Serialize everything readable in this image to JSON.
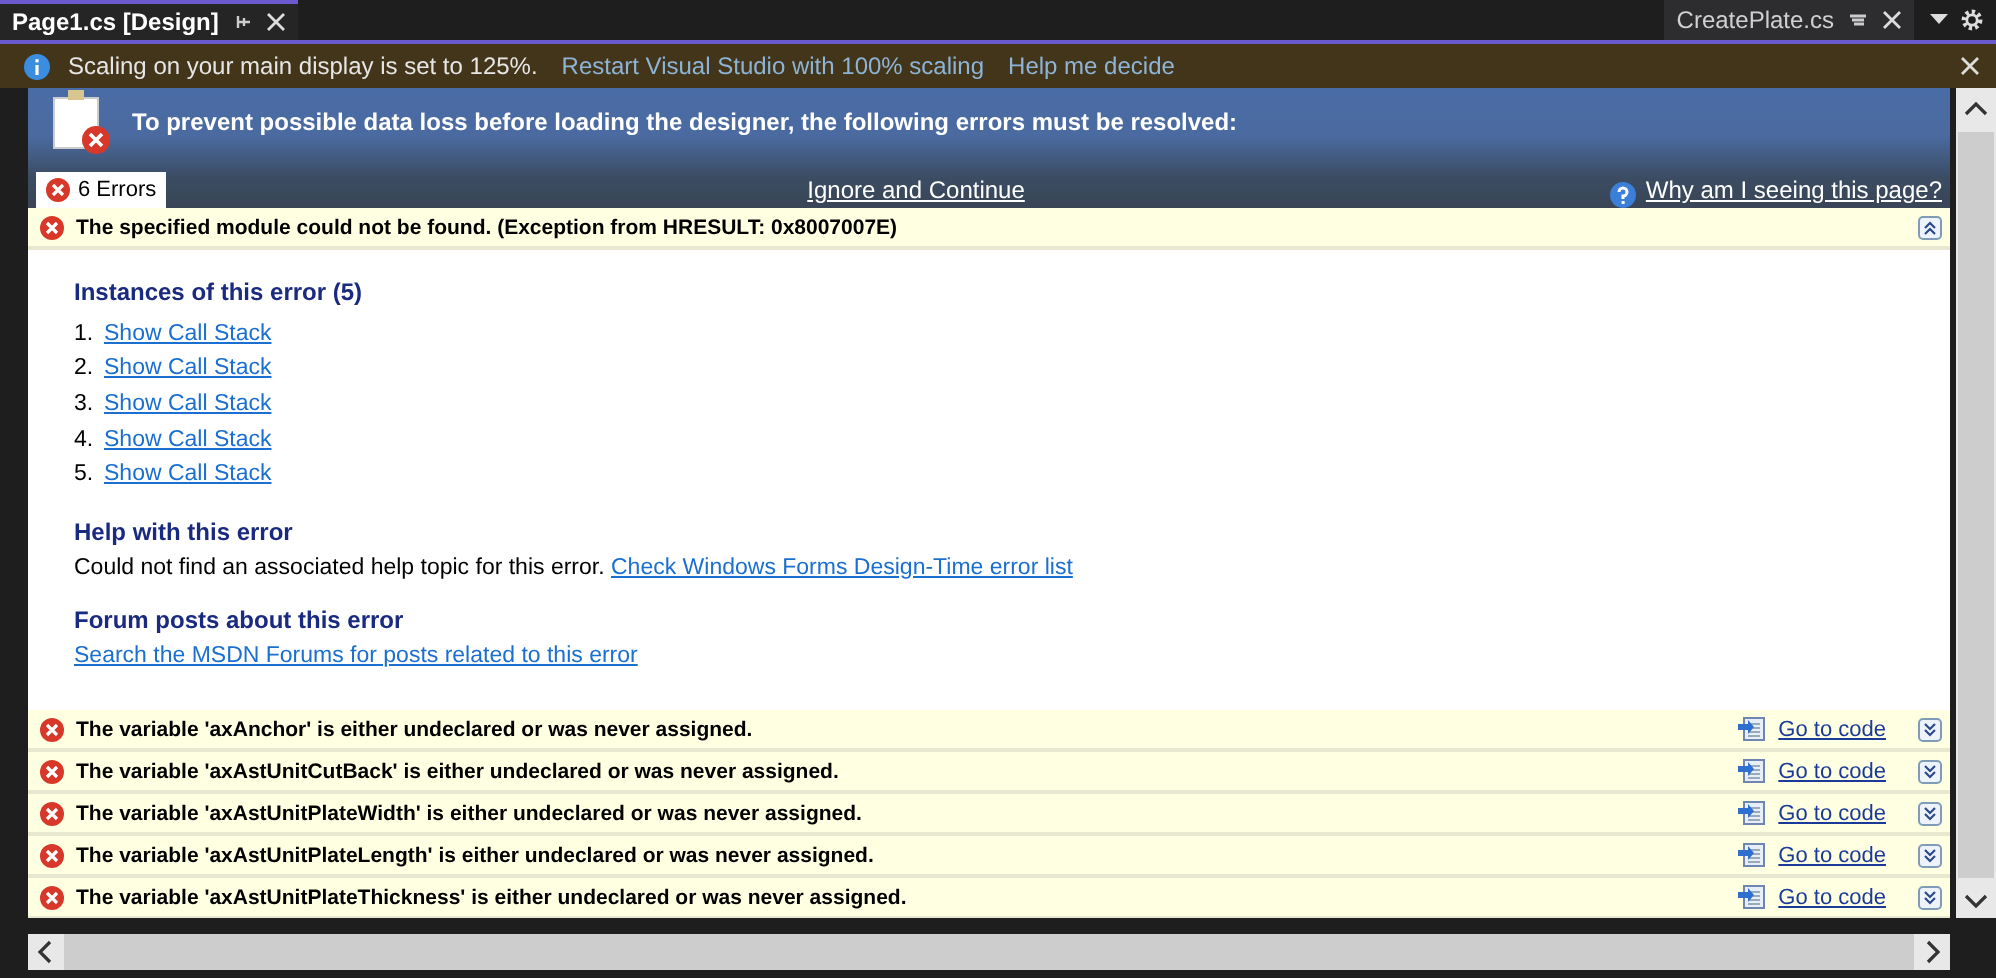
{
  "document_tab": {
    "label": "Page1.cs [Design]",
    "selected": true
  },
  "preview_tab": {
    "label": "CreatePlate.cs",
    "selected": false
  },
  "infobar": {
    "message": "Scaling on your main display is set to 125%.",
    "links": [
      "Restart Visual Studio with 100% scaling",
      "Help me decide"
    ]
  },
  "designer": {
    "heading": "To prevent possible data loss before loading the designer, the following errors must be resolved:",
    "error_tab": "6 Errors",
    "ignore_link": "Ignore and Continue",
    "help_link": "Why am I seeing this page?",
    "errors": [
      {
        "message": "The specified module could not be found. (Exception from HRESULT: 0x8007007E)",
        "expanded": true,
        "instances_heading": "Instances of this error (5)",
        "instances": [
          {
            "number": "1.",
            "link": "Show Call Stack"
          },
          {
            "number": "2.",
            "link": "Show Call Stack"
          },
          {
            "number": "3.",
            "link": "Show Call Stack"
          },
          {
            "number": "4.",
            "link": "Show Call Stack"
          },
          {
            "number": "5.",
            "link": "Show Call Stack"
          }
        ],
        "help_heading": "Help with this error",
        "help_text": "Could not find an associated help topic for this error.",
        "help_text_link": "Check Windows Forms Design-Time error list",
        "forum_heading": "Forum posts about this error",
        "forum_link": "Search the MSDN Forums for posts related to this error"
      },
      {
        "message": "The variable 'axAnchor' is either undeclared or was never assigned.",
        "expanded": false,
        "goto": "Go to code"
      },
      {
        "message": "The variable 'axAstUnitCutBack' is either undeclared or was never assigned.",
        "expanded": false,
        "goto": "Go to code"
      },
      {
        "message": "The variable 'axAstUnitPlateWidth' is either undeclared or was never assigned.",
        "expanded": false,
        "goto": "Go to code"
      },
      {
        "message": "The variable 'axAstUnitPlateLength' is either undeclared or was never assigned.",
        "expanded": false,
        "goto": "Go to code"
      },
      {
        "message": "The variable 'axAstUnitPlateThickness' is either undeclared or was never assigned.",
        "expanded": false,
        "goto": "Go to code"
      }
    ]
  }
}
